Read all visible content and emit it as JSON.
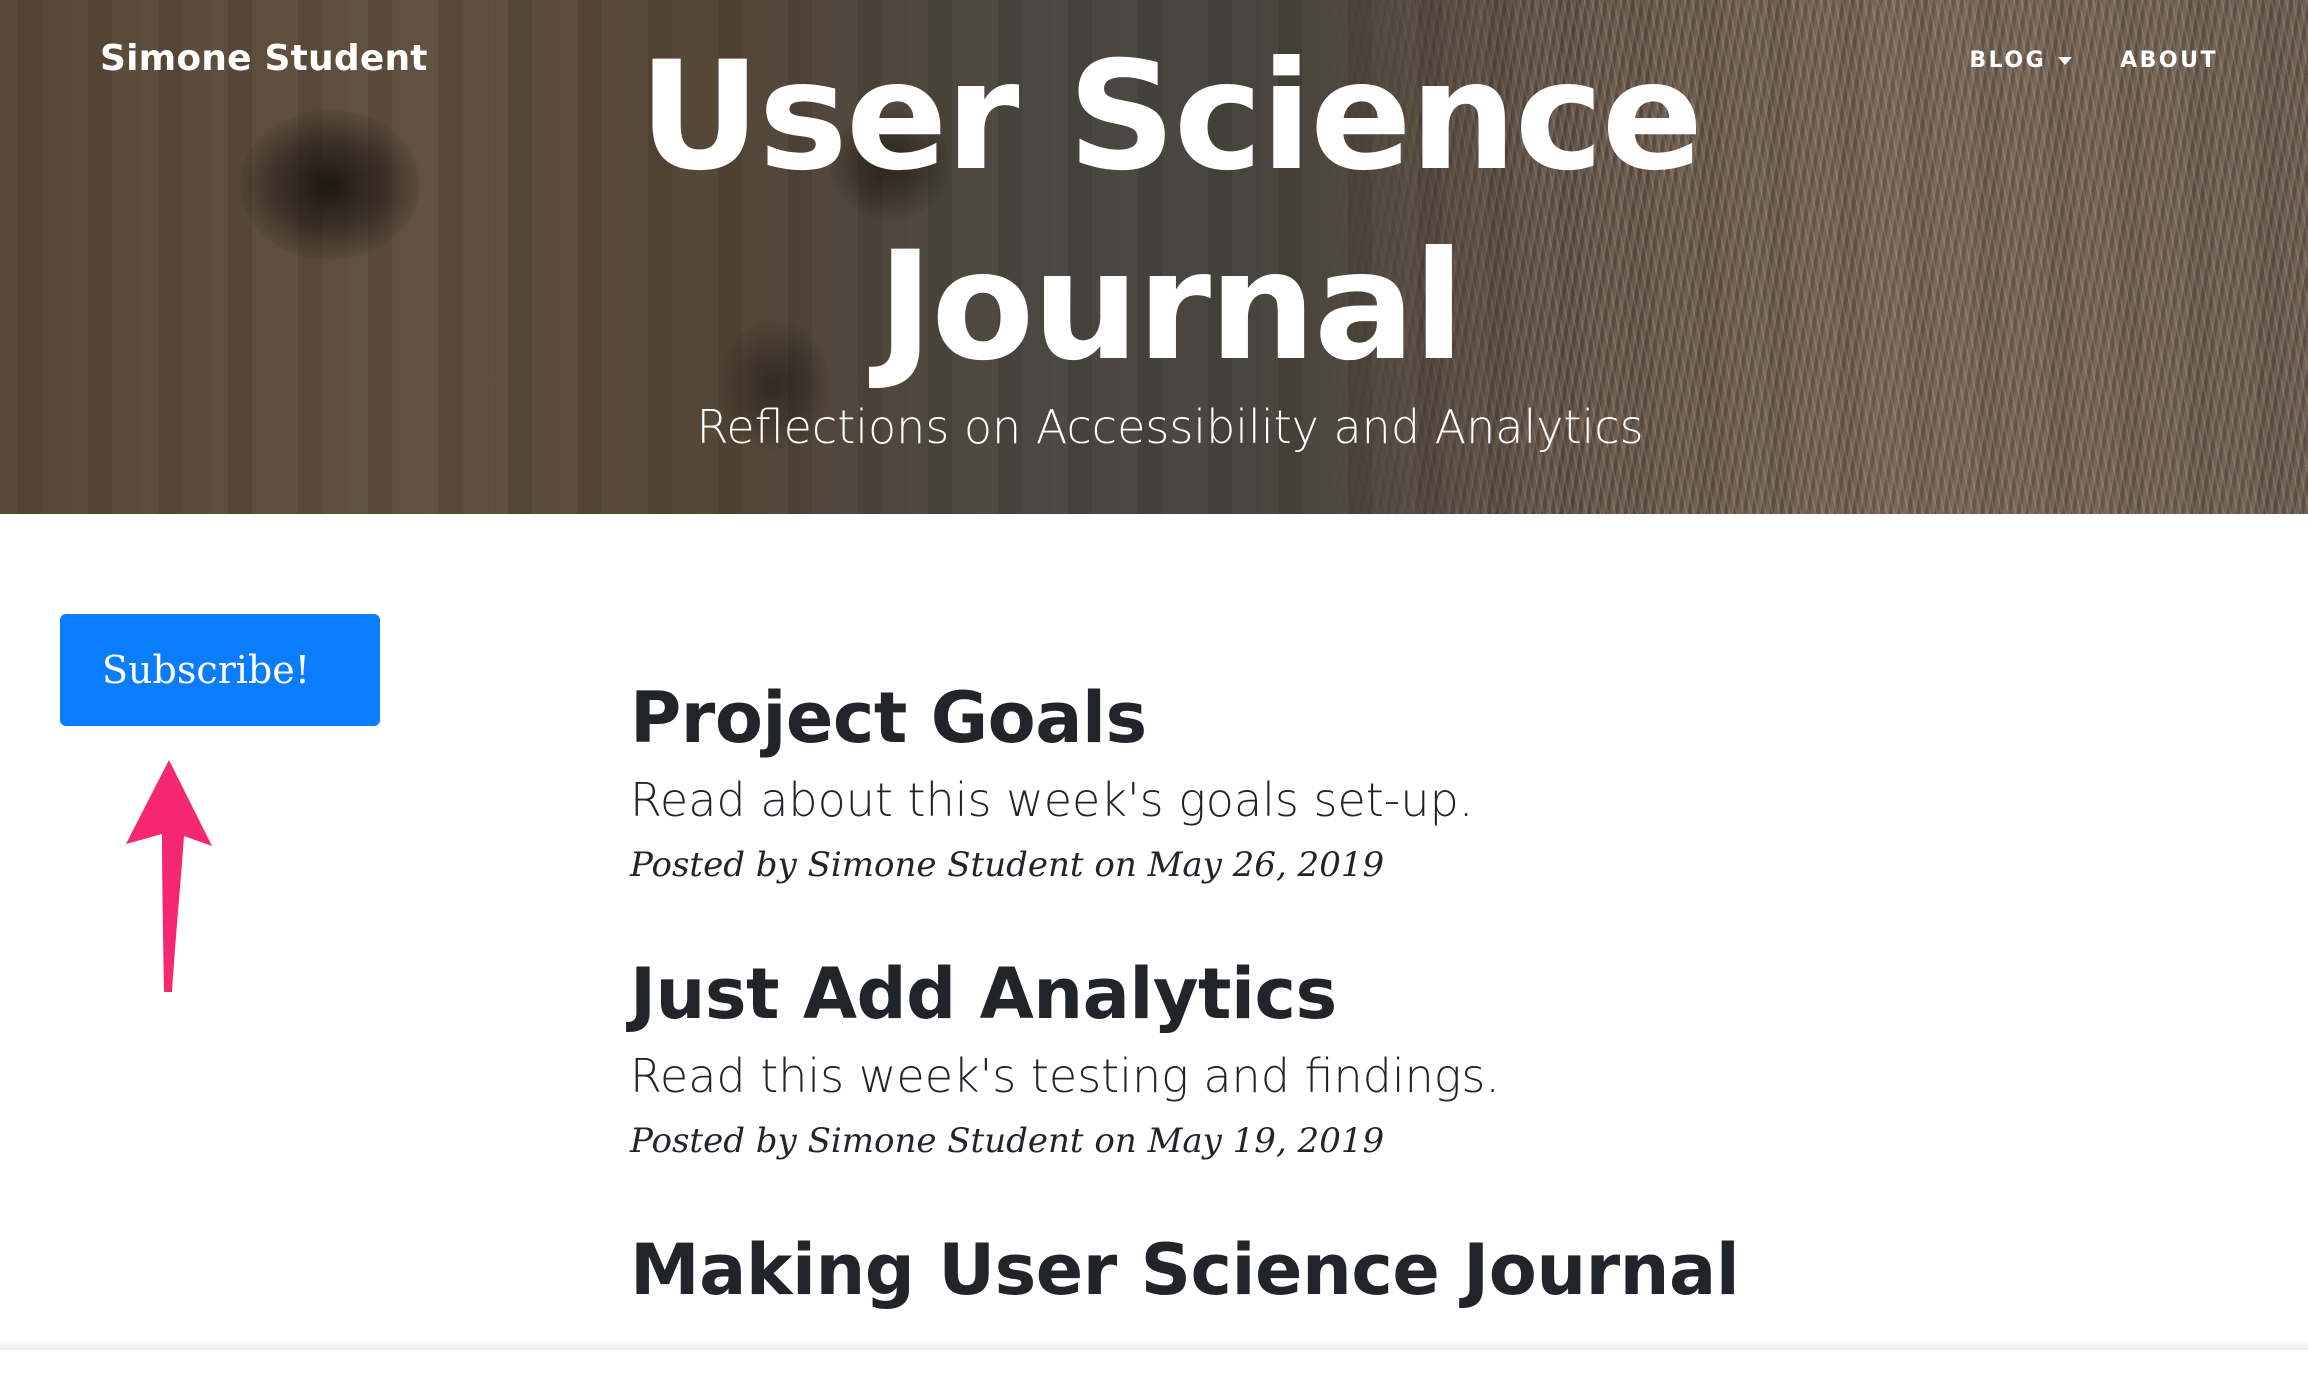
{
  "header": {
    "brand": "Simone Student",
    "nav": [
      {
        "label": "BLOG",
        "has_dropdown": true
      },
      {
        "label": "ABOUT",
        "has_dropdown": false
      }
    ],
    "title_line1": "User Science",
    "title_line2": "Journal",
    "subtitle": "Reflections on Accessibility and Analytics"
  },
  "sidebar": {
    "subscribe_label": "Subscribe!"
  },
  "posts": [
    {
      "title": "Project Goals",
      "subtitle": "Read about this week's goals set-up.",
      "meta_prefix": "Posted by",
      "author": "Simone Student",
      "meta_on": "on",
      "date": "May 26, 2019"
    },
    {
      "title": "Just Add Analytics",
      "subtitle": "Read this week's testing and findings.",
      "meta_prefix": "Posted by",
      "author": "Simone Student",
      "meta_on": "on",
      "date": "May 19, 2019"
    },
    {
      "title": "Making User Science Journal"
    }
  ],
  "colors": {
    "subscribe_button": "#0a7dff",
    "annotation_arrow": "#f5276f",
    "text_dark": "#212529"
  },
  "icons": {
    "dropdown": "caret-down-icon",
    "annotation": "up-arrow-icon"
  }
}
